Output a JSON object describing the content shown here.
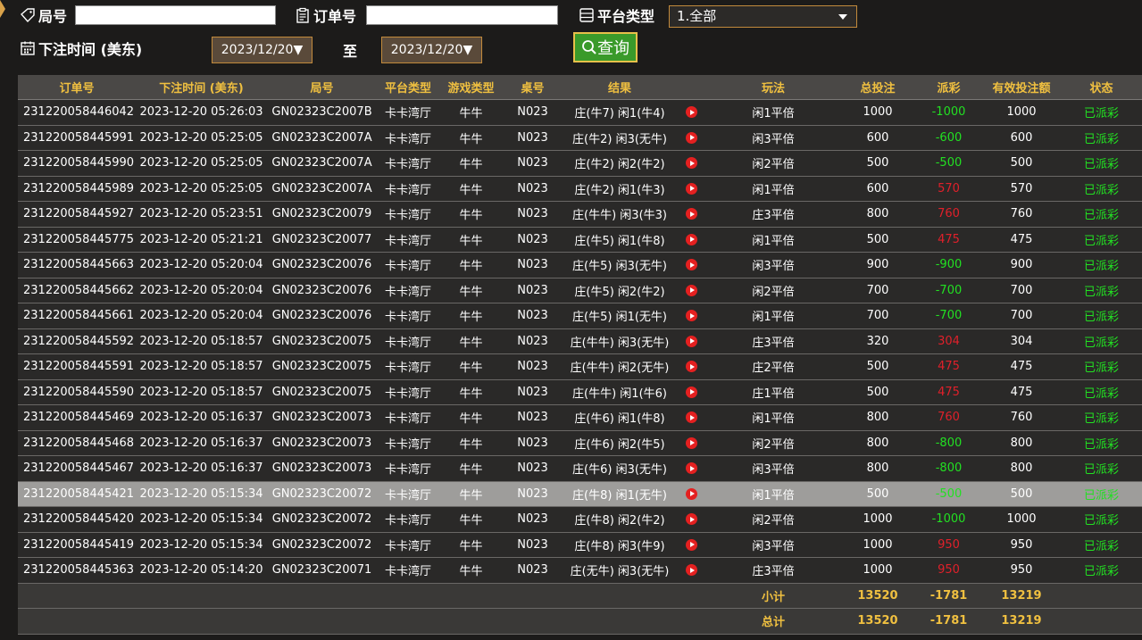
{
  "filters": {
    "round_no_label": "局号",
    "order_no_label": "订单号",
    "platform_label": "平台类型",
    "platform_value": "1.全部",
    "bet_time_label": "下注时间 (美东)",
    "date_from": "2023/12/20▼",
    "to_label": "至",
    "date_to": "2023/12/20▼",
    "query_button": "查询"
  },
  "table": {
    "headers": [
      "订单号",
      "下注时间 (美东)",
      "局号",
      "平台类型",
      "游戏类型",
      "桌号",
      "结果",
      "",
      "玩法",
      "总投注",
      "派彩",
      "有效投注额",
      "状态"
    ],
    "rows": [
      [
        "231220058446042",
        "2023-12-20 05:26:03",
        "GN02323C2007B",
        "卡卡湾厅",
        "牛牛",
        "N023",
        "庄(牛7) 闲1(牛4)",
        "",
        "闲1平倍",
        "1000",
        "-1000",
        "1000",
        "已派彩"
      ],
      [
        "231220058445991",
        "2023-12-20 05:25:05",
        "GN02323C2007A",
        "卡卡湾厅",
        "牛牛",
        "N023",
        "庄(牛2) 闲3(无牛)",
        "",
        "闲3平倍",
        "600",
        "-600",
        "600",
        "已派彩"
      ],
      [
        "231220058445990",
        "2023-12-20 05:25:05",
        "GN02323C2007A",
        "卡卡湾厅",
        "牛牛",
        "N023",
        "庄(牛2) 闲2(牛2)",
        "",
        "闲2平倍",
        "500",
        "-500",
        "500",
        "已派彩"
      ],
      [
        "231220058445989",
        "2023-12-20 05:25:05",
        "GN02323C2007A",
        "卡卡湾厅",
        "牛牛",
        "N023",
        "庄(牛2) 闲1(牛3)",
        "",
        "闲1平倍",
        "600",
        "570",
        "570",
        "已派彩"
      ],
      [
        "231220058445927",
        "2023-12-20 05:23:51",
        "GN02323C20079",
        "卡卡湾厅",
        "牛牛",
        "N023",
        "庄(牛牛) 闲3(牛3)",
        "",
        "庄3平倍",
        "800",
        "760",
        "760",
        "已派彩"
      ],
      [
        "231220058445775",
        "2023-12-20 05:21:21",
        "GN02323C20077",
        "卡卡湾厅",
        "牛牛",
        "N023",
        "庄(牛5) 闲1(牛8)",
        "",
        "闲1平倍",
        "500",
        "475",
        "475",
        "已派彩"
      ],
      [
        "231220058445663",
        "2023-12-20 05:20:04",
        "GN02323C20076",
        "卡卡湾厅",
        "牛牛",
        "N023",
        "庄(牛5) 闲3(无牛)",
        "",
        "闲3平倍",
        "900",
        "-900",
        "900",
        "已派彩"
      ],
      [
        "231220058445662",
        "2023-12-20 05:20:04",
        "GN02323C20076",
        "卡卡湾厅",
        "牛牛",
        "N023",
        "庄(牛5) 闲2(牛2)",
        "",
        "闲2平倍",
        "700",
        "-700",
        "700",
        "已派彩"
      ],
      [
        "231220058445661",
        "2023-12-20 05:20:04",
        "GN02323C20076",
        "卡卡湾厅",
        "牛牛",
        "N023",
        "庄(牛5) 闲1(无牛)",
        "",
        "闲1平倍",
        "700",
        "-700",
        "700",
        "已派彩"
      ],
      [
        "231220058445592",
        "2023-12-20 05:18:57",
        "GN02323C20075",
        "卡卡湾厅",
        "牛牛",
        "N023",
        "庄(牛牛) 闲3(无牛)",
        "",
        "庄3平倍",
        "320",
        "304",
        "304",
        "已派彩"
      ],
      [
        "231220058445591",
        "2023-12-20 05:18:57",
        "GN02323C20075",
        "卡卡湾厅",
        "牛牛",
        "N023",
        "庄(牛牛) 闲2(无牛)",
        "",
        "庄2平倍",
        "500",
        "475",
        "475",
        "已派彩"
      ],
      [
        "231220058445590",
        "2023-12-20 05:18:57",
        "GN02323C20075",
        "卡卡湾厅",
        "牛牛",
        "N023",
        "庄(牛牛) 闲1(牛6)",
        "",
        "庄1平倍",
        "500",
        "475",
        "475",
        "已派彩"
      ],
      [
        "231220058445469",
        "2023-12-20 05:16:37",
        "GN02323C20073",
        "卡卡湾厅",
        "牛牛",
        "N023",
        "庄(牛6) 闲1(牛8)",
        "",
        "闲1平倍",
        "800",
        "760",
        "760",
        "已派彩"
      ],
      [
        "231220058445468",
        "2023-12-20 05:16:37",
        "GN02323C20073",
        "卡卡湾厅",
        "牛牛",
        "N023",
        "庄(牛6) 闲2(牛5)",
        "",
        "闲2平倍",
        "800",
        "-800",
        "800",
        "已派彩"
      ],
      [
        "231220058445467",
        "2023-12-20 05:16:37",
        "GN02323C20073",
        "卡卡湾厅",
        "牛牛",
        "N023",
        "庄(牛6) 闲3(无牛)",
        "",
        "闲3平倍",
        "800",
        "-800",
        "800",
        "已派彩"
      ],
      [
        "231220058445421",
        "2023-12-20 05:15:34",
        "GN02323C20072",
        "卡卡湾厅",
        "牛牛",
        "N023",
        "庄(牛8) 闲1(无牛)",
        "",
        "闲1平倍",
        "500",
        "-500",
        "500",
        "已派彩"
      ],
      [
        "231220058445420",
        "2023-12-20 05:15:34",
        "GN02323C20072",
        "卡卡湾厅",
        "牛牛",
        "N023",
        "庄(牛8) 闲2(牛2)",
        "",
        "闲2平倍",
        "1000",
        "-1000",
        "1000",
        "已派彩"
      ],
      [
        "231220058445419",
        "2023-12-20 05:15:34",
        "GN02323C20072",
        "卡卡湾厅",
        "牛牛",
        "N023",
        "庄(牛8) 闲3(牛9)",
        "",
        "闲3平倍",
        "1000",
        "950",
        "950",
        "已派彩"
      ],
      [
        "231220058445363",
        "2023-12-20 05:14:20",
        "GN02323C20071",
        "卡卡湾厅",
        "牛牛",
        "N023",
        "庄(无牛) 闲3(无牛)",
        "",
        "庄3平倍",
        "1000",
        "950",
        "950",
        "已派彩"
      ]
    ],
    "highlighted_row": 15,
    "subtotal": {
      "label": "小计",
      "total_bet": "13520",
      "payout": "-1781",
      "valid_bet": "13219"
    },
    "total": {
      "label": "总计",
      "total_bet": "13520",
      "payout": "-1781",
      "valid_bet": "13219"
    }
  },
  "colors": {
    "header_text": "#f0c040",
    "negative": "#22e022",
    "positive": "#e0202a",
    "status": "#22e022"
  }
}
